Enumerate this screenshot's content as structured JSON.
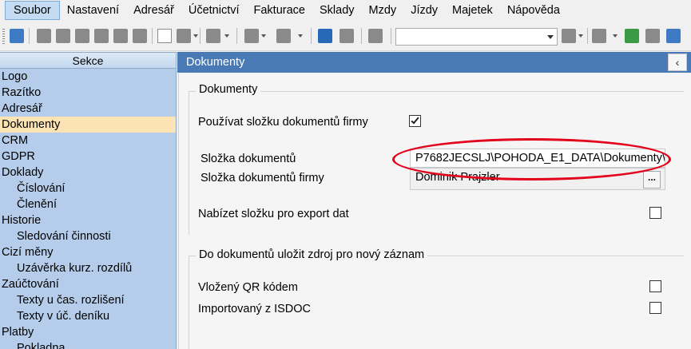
{
  "menu": {
    "items": [
      "Soubor",
      "Nastavení",
      "Adresář",
      "Účetnictví",
      "Fakturace",
      "Sklady",
      "Mzdy",
      "Jízdy",
      "Majetek",
      "Nápověda"
    ]
  },
  "toolbar": {
    "combo_value": ""
  },
  "sidebar": {
    "title": "Sekce",
    "items": [
      {
        "label": "Logo",
        "sub": false
      },
      {
        "label": "Razítko",
        "sub": false
      },
      {
        "label": "Adresář",
        "sub": false
      },
      {
        "label": "Dokumenty",
        "sub": false,
        "selected": true
      },
      {
        "label": "CRM",
        "sub": false
      },
      {
        "label": "GDPR",
        "sub": false
      },
      {
        "label": "Doklady",
        "sub": false
      },
      {
        "label": "Číslování",
        "sub": true
      },
      {
        "label": "Členění",
        "sub": true
      },
      {
        "label": "Historie",
        "sub": false
      },
      {
        "label": "Sledování činnosti",
        "sub": true
      },
      {
        "label": "Cizí měny",
        "sub": false
      },
      {
        "label": "Uzávěrka kurz. rozdílů",
        "sub": true
      },
      {
        "label": "Zaúčtování",
        "sub": false
      },
      {
        "label": "Texty u čas. rozlišení",
        "sub": true
      },
      {
        "label": "Texty v úč. deníku",
        "sub": true
      },
      {
        "label": "Platby",
        "sub": false
      },
      {
        "label": "Pokladna",
        "sub": true
      }
    ]
  },
  "main": {
    "title": "Dokumenty",
    "collapse_glyph": "‹",
    "group1": {
      "title": "Dokumenty",
      "use_company_folder_label": "Používat složku dokumentů firmy",
      "use_company_folder_checked": true,
      "folder_label": "Složka dokumentů",
      "folder_value": "P7682JECSLJ\\POHODA_E1_DATA\\Dokumenty\\",
      "company_folder_label": "Složka dokumentů firmy",
      "company_folder_value": "Dominik Prajzler",
      "browse_label": "...",
      "offer_export_label": "Nabízet složku pro export dat",
      "offer_export_checked": false
    },
    "group2": {
      "title": "Do dokumentů uložit zdroj pro nový záznam",
      "qr_label": "Vložený QR kódem",
      "qr_checked": false,
      "isdoc_label": "Importovaný z ISDOC",
      "isdoc_checked": false
    }
  },
  "colors": {
    "header_blue": "#4a7ab5",
    "sidebar_blue": "#b5cdea",
    "selected_item": "#fbe3b4",
    "annotation_red": "#e3001b"
  }
}
